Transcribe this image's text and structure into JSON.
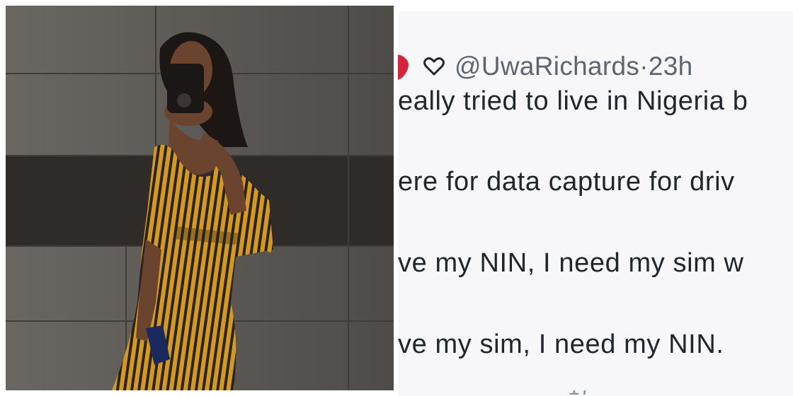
{
  "photo": {
    "alt_subject": "mirror selfie woman striped jumpsuit",
    "colors": {
      "wall": "#5e5b57",
      "wall_band": "#2e2b28",
      "stripe_yellow": "#d39a1e",
      "stripe_dark": "#2a2219",
      "skin": "#6b4430",
      "phone_case": "#1a1716"
    }
  },
  "tweet": {
    "icons": [
      "red-heart-icon",
      "outline-heart-icon"
    ],
    "handle": "@UwaRichards",
    "separator": " · ",
    "timestamp": "23h",
    "lines": [
      "eally tried to live in Nigeria b",
      "ere for data capture for driv",
      "ve my NIN, I need my sim w",
      "ve my sim, I need my NIN."
    ],
    "colors": {
      "text": "#1f262d",
      "muted": "#5c6670",
      "heart_red": "#d4233b",
      "background": "#f7f7f9"
    }
  }
}
